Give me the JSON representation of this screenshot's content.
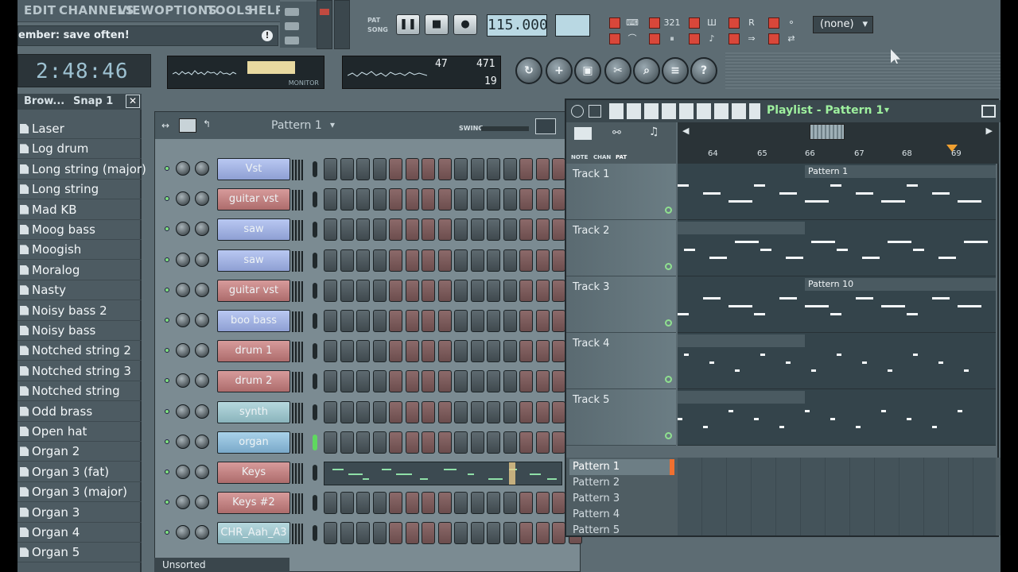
{
  "menu": [
    "EDIT",
    "CHANNELS",
    "VIEW",
    "OPTIONS",
    "TOOLS",
    "HELP"
  ],
  "hint": "ember: save often!",
  "song_time": "2:48:46",
  "transport": {
    "mode_pat": "PAT",
    "mode_song": "SONG",
    "tempo": "115.000",
    "cpu": "47",
    "mem": "471",
    "poly": "19"
  },
  "monitor_label": "MONITOR",
  "none_select": "(none)",
  "browser": {
    "title": "Brow...",
    "snap": "Snap 1",
    "items": [
      "Laser",
      "Log drum",
      "Long string (major)",
      "Long string",
      "Mad KB",
      "Moog bass",
      "Moogish",
      "Moralog",
      "Nasty",
      "Noisy bass 2",
      "Noisy bass",
      "Notched string 2",
      "Notched string 3",
      "Notched string",
      "Odd brass",
      "Open hat",
      "Organ 2",
      "Organ 3 (fat)",
      "Organ 3 (major)",
      "Organ 3",
      "Organ 4",
      "Organ 5"
    ]
  },
  "stepseq": {
    "pattern": "Pattern 1",
    "swing_label": "SWING",
    "channels": [
      {
        "name": "Vst",
        "color": "blue"
      },
      {
        "name": "guitar vst",
        "color": "red"
      },
      {
        "name": "saw",
        "color": "blue"
      },
      {
        "name": "saw",
        "color": "blue"
      },
      {
        "name": "guitar vst",
        "color": "red"
      },
      {
        "name": "boo bass",
        "color": "blue"
      },
      {
        "name": "drum 1",
        "color": "red"
      },
      {
        "name": "drum 2",
        "color": "red"
      },
      {
        "name": "synth",
        "color": "teal"
      },
      {
        "name": "organ",
        "color": "lblue"
      },
      {
        "name": "Keys",
        "color": "red"
      },
      {
        "name": "Keys #2",
        "color": "red"
      },
      {
        "name": "CHR_Aah_A3",
        "color": "teal"
      }
    ],
    "filter": "Unsorted"
  },
  "playlist": {
    "title": "Playlist - Pattern 1",
    "modes": [
      "NOTE",
      "CHAN",
      "PAT"
    ],
    "ruler": [
      "64",
      "65",
      "66",
      "67",
      "68",
      "69"
    ],
    "tracks": [
      {
        "name": "Track 1",
        "block": "Pattern 1"
      },
      {
        "name": "Track 2",
        "block": ""
      },
      {
        "name": "Track 3",
        "block": "Pattern 10"
      },
      {
        "name": "Track 4",
        "block": ""
      },
      {
        "name": "Track 5",
        "block": ""
      }
    ],
    "patterns": [
      "Pattern 1",
      "Pattern 2",
      "Pattern 3",
      "Pattern 4",
      "Pattern 5"
    ]
  }
}
